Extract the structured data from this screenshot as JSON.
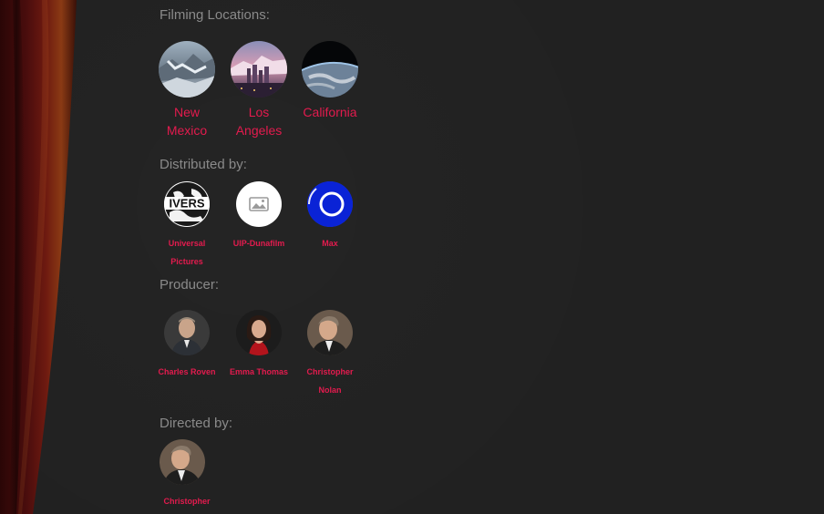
{
  "sections": {
    "filming_locations": {
      "title": "Filming Locations:",
      "items": [
        {
          "label": "New Mexico"
        },
        {
          "label": "Los Angeles"
        },
        {
          "label": "California"
        }
      ]
    },
    "distributed_by": {
      "title": "Distributed by:",
      "items": [
        {
          "label": "Universal Pictures",
          "logo_text": "IVERS"
        },
        {
          "label": "UIP-Dunafilm",
          "icon": "image-placeholder-icon"
        },
        {
          "label": "Max",
          "icon": "max-ring-logo"
        }
      ]
    },
    "producer": {
      "title": "Producer:",
      "items": [
        {
          "label": "Charles Roven"
        },
        {
          "label": "Emma Thomas"
        },
        {
          "label": "Christopher Nolan"
        }
      ]
    },
    "directed_by": {
      "title": "Directed by:",
      "items": [
        {
          "label": "Christopher"
        }
      ]
    }
  },
  "colors": {
    "background": "#212121",
    "link": "#e31b4e",
    "section_title": "#8a8a8a",
    "curtain": "#5a1010"
  }
}
